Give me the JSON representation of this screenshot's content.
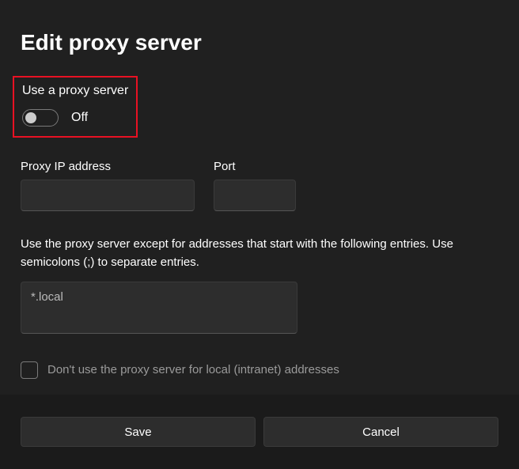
{
  "dialog": {
    "title": "Edit proxy server",
    "toggle": {
      "label": "Use a proxy server",
      "state": "Off"
    },
    "fields": {
      "ip_label": "Proxy IP address",
      "ip_value": "",
      "port_label": "Port",
      "port_value": ""
    },
    "exceptions": {
      "help": "Use the proxy server except for addresses that start with the following entries. Use semicolons (;) to separate entries.",
      "value": "*.local"
    },
    "checkbox": {
      "label": "Don't use the proxy server for local (intranet) addresses"
    },
    "buttons": {
      "save": "Save",
      "cancel": "Cancel"
    }
  }
}
